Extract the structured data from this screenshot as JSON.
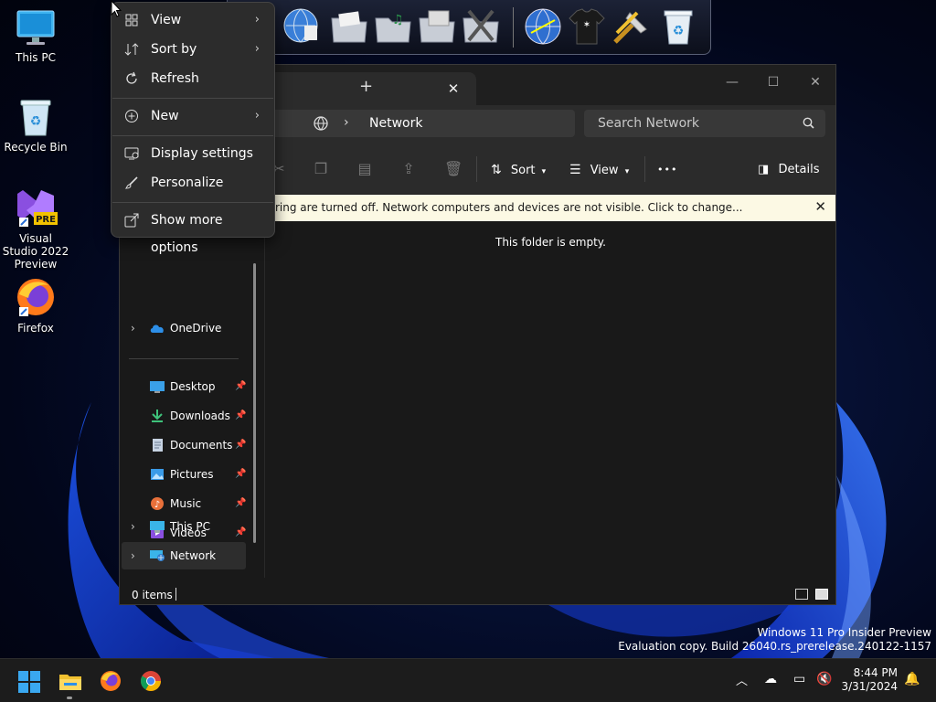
{
  "desktop": {
    "icons": [
      {
        "label": "This PC"
      },
      {
        "label": "Recycle Bin"
      },
      {
        "label": "Visual Studio 2022 Preview",
        "badge": "PRE"
      },
      {
        "label": "Firefox"
      }
    ]
  },
  "context_menu": {
    "items": [
      {
        "label": "View",
        "icon": "grid-icon",
        "submenu": true
      },
      {
        "label": "Sort by",
        "icon": "sort-icon",
        "submenu": true
      },
      {
        "label": "Refresh",
        "icon": "refresh-icon",
        "submenu": false
      },
      {
        "label": "New",
        "icon": "plus-circle-icon",
        "submenu": true
      },
      {
        "label": "Display settings",
        "icon": "display-icon",
        "submenu": false
      },
      {
        "label": "Personalize",
        "icon": "brush-icon",
        "submenu": false
      },
      {
        "label": "Show more options",
        "icon": "share-icon",
        "submenu": false
      }
    ]
  },
  "explorer": {
    "tab_close": "✕",
    "new_tab": "+",
    "window_controls": {
      "minimize": "—",
      "maximize": "☐",
      "close": "✕"
    },
    "address": {
      "location": "Network"
    },
    "search": {
      "placeholder": "Search Network"
    },
    "commands": {
      "sort": "Sort",
      "view": "View",
      "more": "•••",
      "details": "Details"
    },
    "infobar": {
      "text": "ring are turned off. Network computers and devices are not visible. Click to change...",
      "close": "✕"
    },
    "nav": {
      "onedrive": "OneDrive",
      "quick_access": [
        {
          "label": "Desktop"
        },
        {
          "label": "Downloads"
        },
        {
          "label": "Documents"
        },
        {
          "label": "Pictures"
        },
        {
          "label": "Music"
        },
        {
          "label": "Videos"
        }
      ],
      "this_pc": "This PC",
      "network": "Network"
    },
    "content": {
      "empty_message": "This folder is empty."
    },
    "status": {
      "items": "0 items"
    }
  },
  "watermark": {
    "line1": "Windows 11 Pro Insider Preview",
    "line2": "Evaluation copy. Build 26040.rs_prerelease.240122-1157"
  },
  "taskbar": {
    "clock": {
      "time": "8:44 PM",
      "date": "3/31/2024"
    }
  },
  "colors": {
    "accent": "#0078d4",
    "infobar_bg": "#fcf9e4",
    "menu_bg": "#2c2c2c",
    "window_bg": "#191919"
  }
}
